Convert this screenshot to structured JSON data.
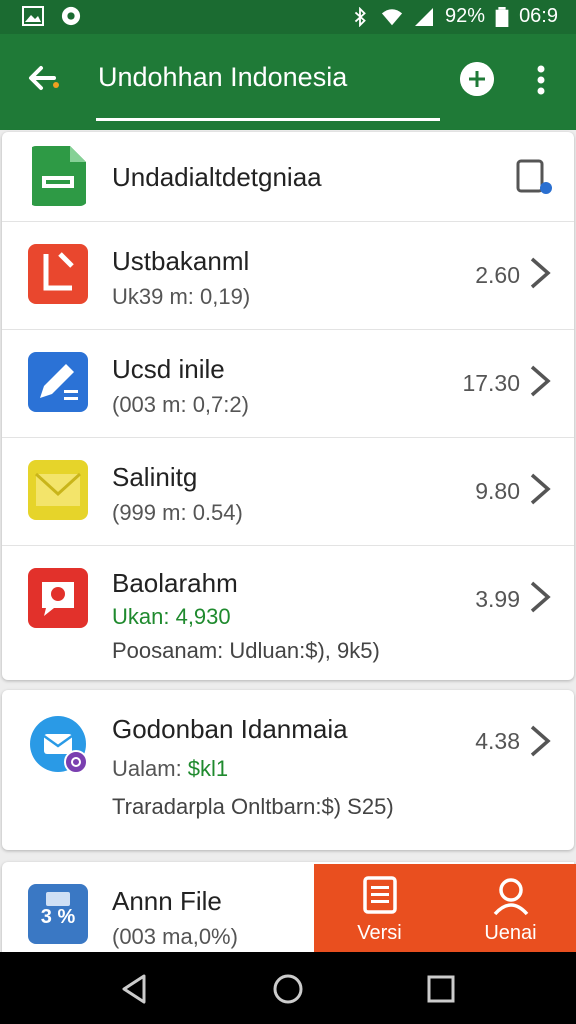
{
  "status_bar": {
    "battery_pct": "92%",
    "time": "06:9"
  },
  "app_bar": {
    "title": "Undohhan Indonesia"
  },
  "colors": {
    "primary": "#1f7a37",
    "status_bar": "#1b6b31",
    "accent": "#e94f1f",
    "positive": "#1f8a2e"
  },
  "list_card1": [
    {
      "icon": "green-sheet-icon",
      "title": "Undadialtdetgniaa",
      "trailing_icon": "device-edit-icon"
    },
    {
      "icon": "red-document-icon",
      "title": "Ustbakanml",
      "subtitle": "Uk39 m: 0,19)",
      "value": "2.60"
    },
    {
      "icon": "blue-edit-icon",
      "title": "Ucsd inile",
      "subtitle": "(003 m: 0,7:2)",
      "value": "17.30"
    },
    {
      "icon": "yellow-mail-icon",
      "title": "Salinitg",
      "subtitle": "(999 m: 0.54)",
      "value": "9.80"
    },
    {
      "icon": "red-chat-icon",
      "title": "Baolarahm",
      "subtitle_green": "Ukan: 4,930",
      "subtitle": "Poosanam: Udluan:$), 9k5)",
      "value": "3.99"
    }
  ],
  "list_card2": {
    "icon": "blue-message-icon",
    "title": "Godonban Idanmaia",
    "subtitle_prefix": "Ualam: ",
    "subtitle_green": "$kl1",
    "subtitle": "Traradarpla Onltbarn:$) S25)",
    "value": "4.38"
  },
  "list_card3": {
    "icon": "blue-tablet-icon",
    "icon_text": "3 %",
    "title": "Annn File",
    "subtitle": "(003 ma,0%)"
  },
  "actions": [
    {
      "label": "Versi",
      "icon": "document-list-icon"
    },
    {
      "label": "Uenai",
      "icon": "person-icon"
    }
  ]
}
